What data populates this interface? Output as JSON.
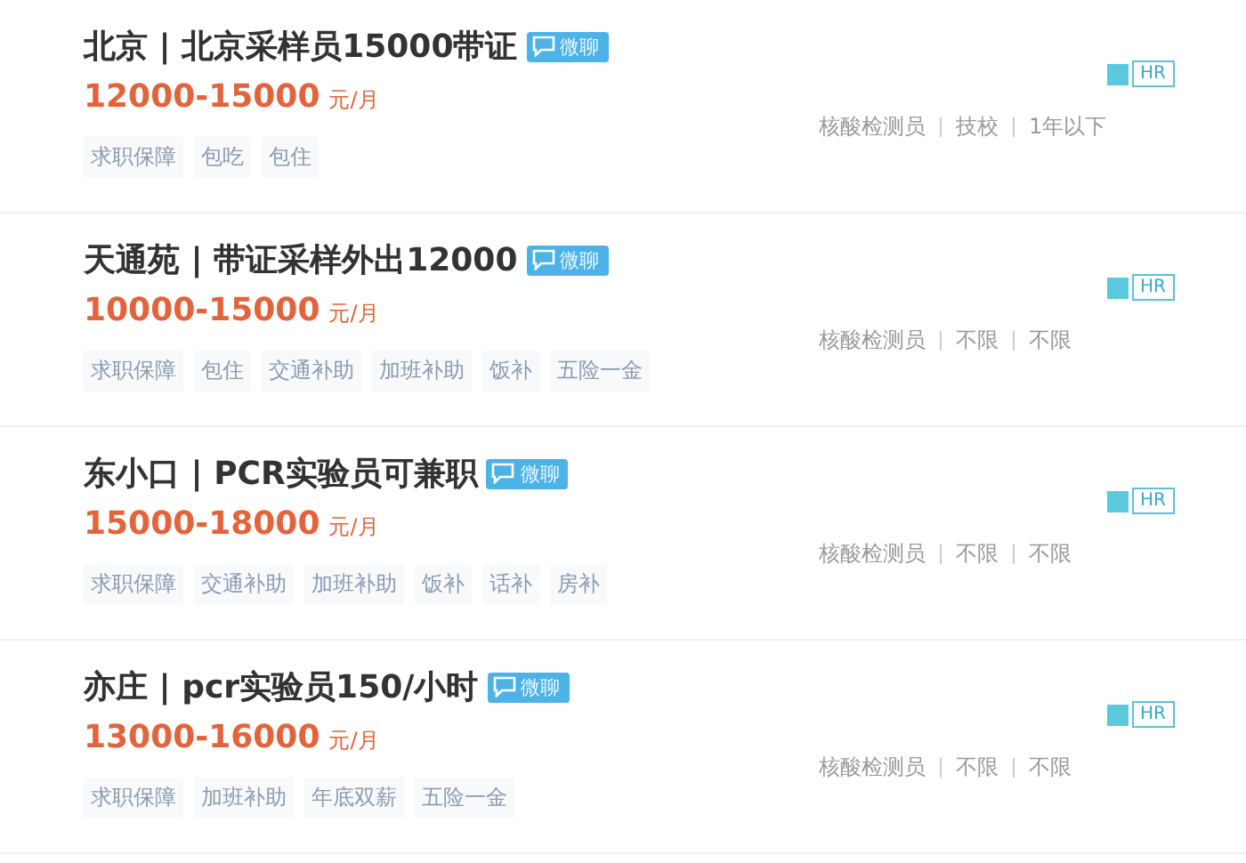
{
  "jobs": [
    {
      "title": "北京 | 北京采样员15000带证",
      "chat_badge": "微聊",
      "salary": "12000-15000",
      "salary_unit": "元/月",
      "tags": [
        "求职保障",
        "包吃",
        "包住"
      ],
      "hr_badge": "HR",
      "requirements": [
        "核酸检测员",
        "技校",
        "1年以下"
      ]
    },
    {
      "title": "天通苑 | 带证采样外出12000",
      "chat_badge": "微聊",
      "salary": "10000-15000",
      "salary_unit": "元/月",
      "tags": [
        "求职保障",
        "包住",
        "交通补助",
        "加班补助",
        "饭补",
        "五险一金"
      ],
      "hr_badge": "HR",
      "requirements": [
        "核酸检测员",
        "不限",
        "不限"
      ]
    },
    {
      "title": "东小口 | PCR实验员可兼职",
      "chat_badge": "微聊",
      "salary": "15000-18000",
      "salary_unit": "元/月",
      "tags": [
        "求职保障",
        "交通补助",
        "加班补助",
        "饭补",
        "话补",
        "房补"
      ],
      "hr_badge": "HR",
      "requirements": [
        "核酸检测员",
        "不限",
        "不限"
      ]
    },
    {
      "title": "亦庄 | pcr实验员150/小时",
      "chat_badge": "微聊",
      "salary": "13000-16000",
      "salary_unit": "元/月",
      "tags": [
        "求职保障",
        "加班补助",
        "年底双薪",
        "五险一金"
      ],
      "hr_badge": "HR",
      "requirements": [
        "核酸检测员",
        "不限",
        "不限"
      ]
    }
  ]
}
